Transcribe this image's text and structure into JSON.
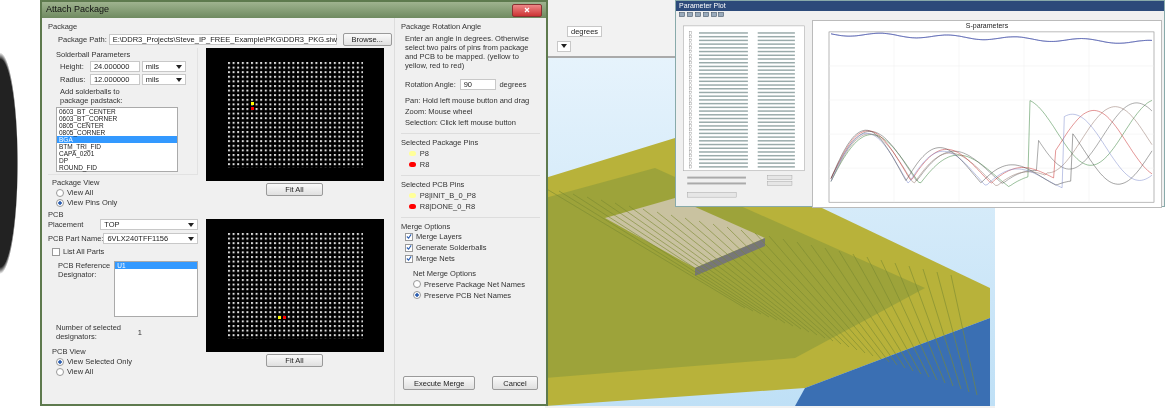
{
  "background_window": {
    "angle_unit": "degrees"
  },
  "dialog": {
    "title": "Attach Package",
    "package": {
      "heading": "Package",
      "path_label": "Package Path:",
      "path_value": "E:\\DDR3_Projects\\Steve_IP_FREE_Example\\PKG\\DDR3_PKG.siw",
      "browse_button": "Browse...",
      "solderball": {
        "heading": "Solderball Parameters",
        "fields": [
          {
            "label": "Height:",
            "value": "24.000000",
            "unit": "mils"
          },
          {
            "label": "Radius:",
            "value": "12.000000",
            "unit": "mils"
          }
        ],
        "padstack_label": "Add solderballs to package padstack:",
        "padstacks": [
          {
            "label": "0603_BT_CENTER",
            "selected": false
          },
          {
            "label": "0603_BT_CORNER",
            "selected": false
          },
          {
            "label": "0805_CENTER",
            "selected": false
          },
          {
            "label": "0805_CORNER",
            "selected": false
          },
          {
            "label": "BGA",
            "selected": true
          },
          {
            "label": "BTM_TRI_FID",
            "selected": false
          },
          {
            "label": "CAPA_0201",
            "selected": false
          },
          {
            "label": "DP",
            "selected": false
          },
          {
            "label": "ROUND_FID",
            "selected": false
          }
        ]
      },
      "view": {
        "heading": "Package View",
        "options": [
          {
            "label": "View All",
            "selected": false
          },
          {
            "label": "View Pins Only",
            "selected": true
          }
        ]
      },
      "fit_button": "Fit All"
    },
    "pcb": {
      "heading": "PCB",
      "placement_label": "Placement",
      "placement": "TOP",
      "part_label": "PCB Part Name:",
      "part": "6VLX240TFF1156",
      "list_all": {
        "label": "List All Parts",
        "checked": false
      },
      "refdes_label": "PCB Reference Designator:",
      "refdes": [
        {
          "label": "U1",
          "selected": true
        }
      ],
      "count_label": "Number of selected designators:",
      "count": "1",
      "view": {
        "heading": "PCB View",
        "options": [
          {
            "label": "View Selected Only",
            "selected": true
          },
          {
            "label": "View All",
            "selected": false
          }
        ]
      },
      "fit_button": "Fit All"
    },
    "rotation": {
      "heading": "Package Rotation Angle",
      "instructions": "Enter an angle in degrees. Otherwise select two pairs of pins from package and PCB to be mapped. (yellow to yellow, red to red)",
      "angle_label": "Rotation Angle:",
      "angle": "90",
      "unit": "degrees",
      "help": [
        "Pan: Hold left mouse button and drag",
        "Zoom: Mouse wheel",
        "Selection: Click left mouse button"
      ]
    },
    "package_pins": {
      "heading": "Selected Package Pins",
      "pins": [
        {
          "label": "P8",
          "color": "#ffff99"
        },
        {
          "label": "R8",
          "color": "#ff0000"
        }
      ]
    },
    "pcb_pins": {
      "heading": "Selected PCB Pins",
      "pins": [
        {
          "label": "P8|INIT_B_0_P8",
          "color": "#ffff99"
        },
        {
          "label": "R8|DONE_0_R8",
          "color": "#ff0000"
        }
      ]
    },
    "merge": {
      "heading": "Merge Options",
      "options": [
        {
          "label": "Merge Layers",
          "checked": true
        },
        {
          "label": "Generate Solderballs",
          "checked": true
        },
        {
          "label": "Merge Nets",
          "checked": true
        }
      ],
      "net_heading": "Net Merge Options",
      "net_options": [
        {
          "label": "Preserve Package Net Names",
          "selected": false
        },
        {
          "label": "Preserve PCB Net Names",
          "selected": true
        }
      ]
    },
    "buttons": [
      "Execute Merge",
      "Cancel"
    ]
  },
  "parameter_plot": {
    "title": "Parameter Plot",
    "plot_title": "S-parameters"
  }
}
